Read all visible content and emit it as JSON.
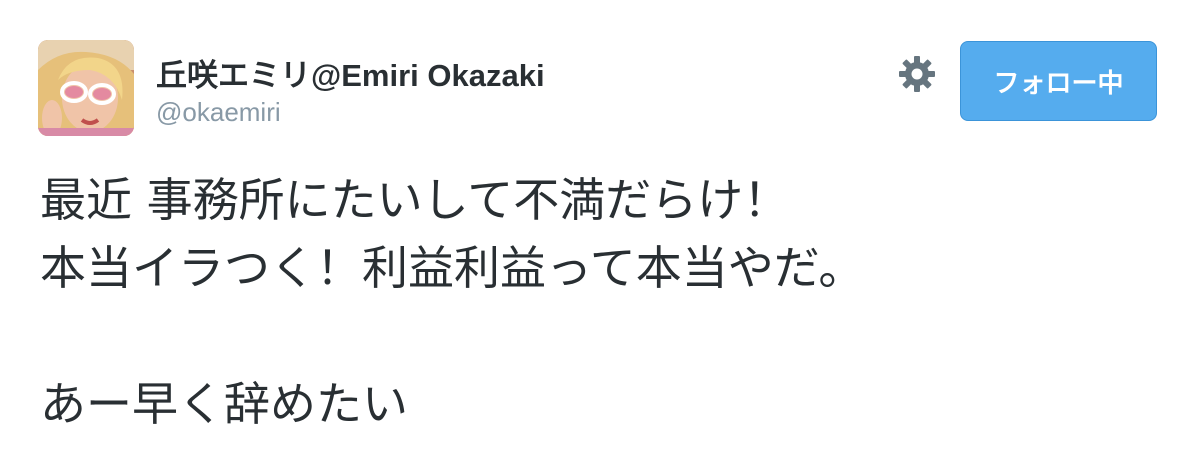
{
  "user": {
    "display_name": "丘咲エミリ@Emiri Okazaki",
    "handle": "@okaemiri",
    "avatar_icon": "profile-photo"
  },
  "actions": {
    "settings_icon": "gear-icon",
    "follow_label": "フォロー中"
  },
  "tweet": {
    "lines": [
      "最近 事務所にたいして不満だらけ！",
      "本当イラつく！利益利益って本当やだ。",
      "",
      "あー早く辞めたい"
    ]
  },
  "colors": {
    "follow_button": "#55acee",
    "handle": "#8899a6",
    "text": "#292f33"
  }
}
